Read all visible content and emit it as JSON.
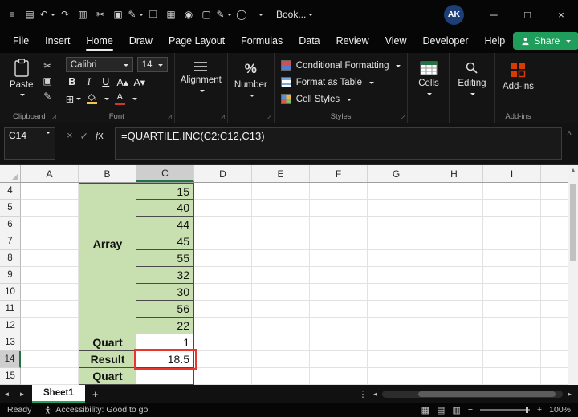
{
  "colors": {
    "accent_green": "#217346",
    "share_green": "#1e9e5a",
    "cell_green": "#c8dfb0",
    "highlight_red": "#e8372c",
    "avatar_blue": "#1d3f77"
  },
  "titlebar": {
    "workbook_name": "Book...",
    "avatar_initials": "AK",
    "icons": [
      {
        "name": "menu-icon",
        "glyph": "≡"
      },
      {
        "name": "save-icon",
        "glyph": "▤"
      },
      {
        "name": "undo-icon",
        "glyph": "↶",
        "dropdown": true
      },
      {
        "name": "redo-icon",
        "glyph": "↷"
      },
      {
        "name": "clipboard-icon",
        "glyph": "▥"
      },
      {
        "name": "cut-icon",
        "glyph": "✂"
      },
      {
        "name": "copy-icon",
        "glyph": "▣"
      },
      {
        "name": "format-painter-icon",
        "glyph": "✎",
        "dropdown": true
      },
      {
        "name": "document-icon",
        "glyph": "❏"
      },
      {
        "name": "print-icon",
        "glyph": "▦"
      },
      {
        "name": "camera-icon",
        "glyph": "◉"
      },
      {
        "name": "window-icon",
        "glyph": "▢"
      },
      {
        "name": "draw-pen-icon",
        "glyph": "✎",
        "dropdown": true
      },
      {
        "name": "record-icon",
        "glyph": "◯"
      },
      {
        "name": "chevron-down-icon",
        "glyph": "",
        "dropdown": true
      }
    ]
  },
  "menubar": {
    "items": [
      "File",
      "Insert",
      "Home",
      "Draw",
      "Page Layout",
      "Formulas",
      "Data",
      "Review",
      "View",
      "Developer",
      "Help"
    ],
    "active": "Home",
    "share": {
      "label": "Share"
    }
  },
  "ribbon": {
    "paste_label": "Paste",
    "clipboard_group_label": "Clipboard",
    "font": {
      "family": "Calibri",
      "size": "14",
      "bold": "B",
      "italic": "I",
      "underline": "U",
      "group_label": "Font"
    },
    "alignment_label": "Alignment",
    "number_label": "Number",
    "styles": {
      "items": [
        "Conditional Formatting",
        "Format as Table",
        "Cell Styles"
      ],
      "group_label": "Styles"
    },
    "cells_label": "Cells",
    "editing_label": "Editing",
    "addins_label": "Add-ins",
    "addins_group_label": "Add-ins"
  },
  "formula_bar": {
    "name_box": "C14",
    "formula": "=QUARTILE.INC(C2:C12,C13)"
  },
  "grid": {
    "columns": [
      "A",
      "B",
      "C",
      "D",
      "E",
      "F",
      "G",
      "H",
      "I"
    ],
    "selected_column": "C",
    "selected_row": 14,
    "merged_label": "Array",
    "rows": [
      {
        "n": 4,
        "c": "15"
      },
      {
        "n": 5,
        "c": "40"
      },
      {
        "n": 6,
        "c": "44"
      },
      {
        "n": 7,
        "c": "45"
      },
      {
        "n": 8,
        "c": "55"
      },
      {
        "n": 9,
        "c": "32"
      },
      {
        "n": 10,
        "c": "30"
      },
      {
        "n": 11,
        "c": "56"
      },
      {
        "n": 12,
        "c": "22"
      },
      {
        "n": 13,
        "b": "Quart",
        "c": "1"
      },
      {
        "n": 14,
        "b": "Result",
        "c": "18.5",
        "highlight": true
      },
      {
        "n": 15,
        "b": "Quart",
        "c": ""
      }
    ]
  },
  "sheet_tabs": {
    "active": "Sheet1",
    "tabs": [
      "Sheet1"
    ]
  },
  "status_bar": {
    "left": "Ready",
    "accessibility": "Accessibility: Good to go",
    "zoom": "100%"
  }
}
